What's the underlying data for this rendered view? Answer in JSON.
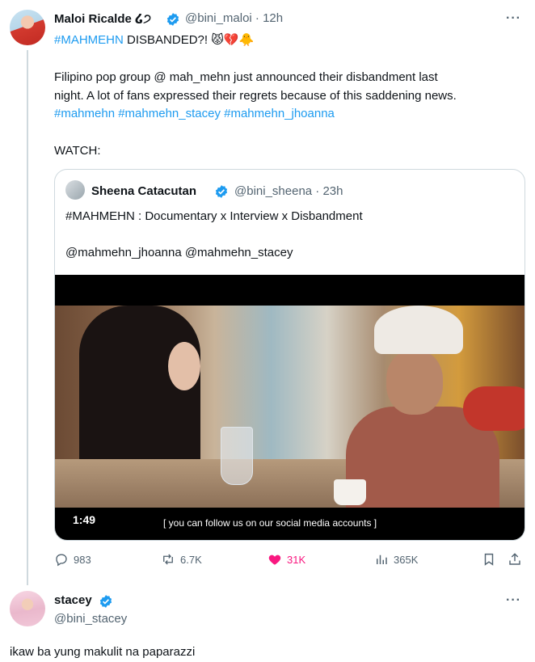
{
  "tweet": {
    "author_name": "Maloi Ricalde",
    "author_emoji": "໒੭",
    "handle_time": "@bini_maloi · 12h",
    "headline_tag": "#MAHMEHN",
    "headline_rest": " DISBANDED?!  😾💔🐥",
    "para1_line1": "Filipino pop group @ mah_mehn just announced their disbandment last",
    "para1_line2": "night. A lot of fans expressed their regrets because of this saddening news.",
    "hashtags": "#mahmehn #mahmehn_stacey #mahmehn_jhoanna",
    "watch": "WATCH:",
    "more": "···"
  },
  "quote": {
    "author_name": "Sheena Catacutan",
    "handle_time": "@bini_sheena · 23h",
    "line1": "#MAHMEHN : Documentary x Interview x Disbandment",
    "line2": "@mahmehn_jhoanna @mahmehn_stacey",
    "video_time": "1:49",
    "subtitle": "[ you can follow us on our social media accounts ]"
  },
  "actions": {
    "replies": "983",
    "reposts": "6.7K",
    "likes": "31K",
    "views": "365K"
  },
  "reply": {
    "author_name": "stacey",
    "handle": "@bini_stacey",
    "text": "ikaw ba yung makulit na paparazzi",
    "more": "···"
  },
  "colors": {
    "accent": "#1d9bf0",
    "like": "#f91880",
    "muted": "#536471"
  }
}
